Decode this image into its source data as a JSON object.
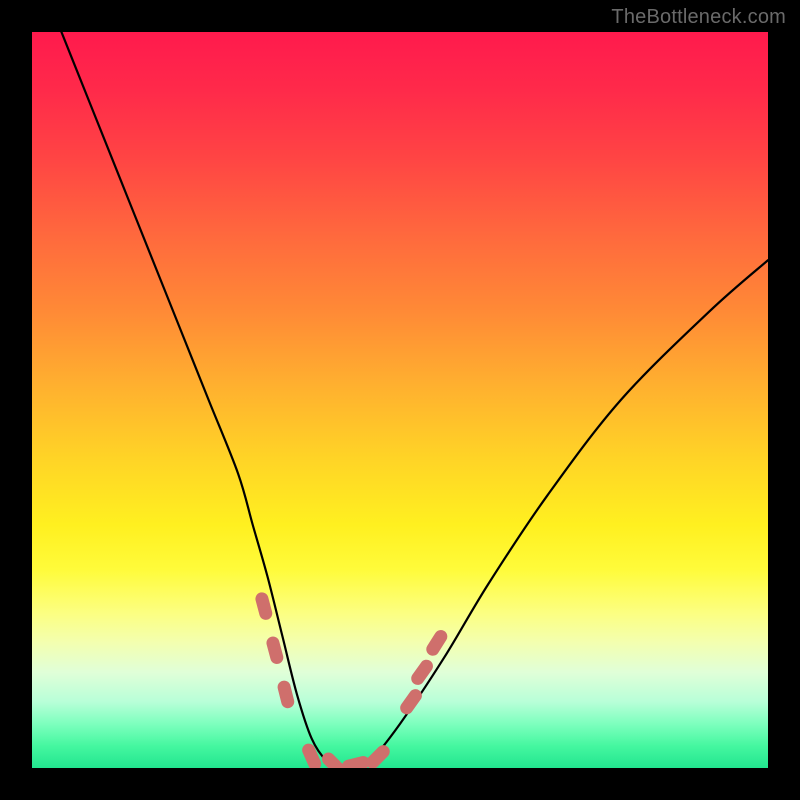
{
  "watermark": "TheBottleneck.com",
  "colors": {
    "frame": "#000000",
    "curve": "#000000",
    "marker": "#cf6f6c"
  },
  "chart_data": {
    "type": "line",
    "title": "",
    "xlabel": "",
    "ylabel": "",
    "xlim": [
      0,
      100
    ],
    "ylim": [
      0,
      100
    ],
    "grid": false,
    "series": [
      {
        "name": "bottleneck-curve",
        "x": [
          0,
          4,
          8,
          12,
          16,
          20,
          24,
          28,
          30,
          32,
          34,
          36,
          38,
          40,
          42,
          44,
          46,
          50,
          56,
          62,
          70,
          80,
          92,
          100
        ],
        "values": [
          110,
          100,
          90,
          80,
          70,
          60,
          50,
          40,
          33,
          26,
          18,
          10,
          4,
          1,
          0,
          0,
          1,
          6,
          15,
          25,
          37,
          50,
          62,
          69
        ]
      }
    ],
    "markers": [
      {
        "x": 31.5,
        "y": 22
      },
      {
        "x": 33.0,
        "y": 16
      },
      {
        "x": 34.5,
        "y": 10
      },
      {
        "x": 38.0,
        "y": 1.5
      },
      {
        "x": 41.0,
        "y": 0.5
      },
      {
        "x": 44.0,
        "y": 0.5
      },
      {
        "x": 47.0,
        "y": 1.5
      },
      {
        "x": 51.5,
        "y": 9
      },
      {
        "x": 53.0,
        "y": 13
      },
      {
        "x": 55.0,
        "y": 17
      }
    ]
  }
}
